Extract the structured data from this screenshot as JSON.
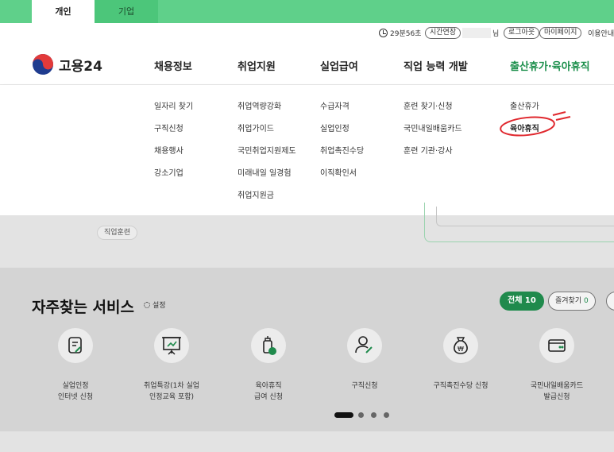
{
  "tabs": [
    {
      "label": "개인",
      "active": true
    },
    {
      "label": "기업",
      "active": false
    }
  ],
  "util": {
    "timer": "29분56초",
    "extend_label": "시간연장",
    "user_suffix": "님",
    "logout_label": "로그아웃",
    "mypage_label": "마이페이지",
    "guide_label": "이용안내"
  },
  "logo": {
    "text": "고용24"
  },
  "gnb": [
    {
      "label": "채용정보"
    },
    {
      "label": "취업지원"
    },
    {
      "label": "실업급여"
    },
    {
      "label": "직업 능력 개발"
    },
    {
      "label": "출산휴가·육아휴직"
    }
  ],
  "submenu": {
    "col1": [
      "일자리 찾기",
      "구직신청",
      "채용행사",
      "강소기업"
    ],
    "col2": [
      "취업역량강화",
      "취업가이드",
      "국민취업지원제도",
      "미래내일 일경험",
      "취업지원금"
    ],
    "col3": [
      "수급자격",
      "실업인정",
      "취업촉진수당",
      "이직확인서"
    ],
    "col4": [
      "훈련 찾기·신청",
      "국민내일배움카드",
      "훈련 기관·강사"
    ],
    "col5": [
      "출산휴가",
      "육아휴직"
    ]
  },
  "background": {
    "chip": "직업훈련"
  },
  "services": {
    "title": "자주찾는 서비스",
    "setting_label": "설정",
    "all_label": "전체 10",
    "fav_label": "즐겨찾기",
    "fav_count": "0",
    "items": [
      {
        "icon": "document-edit-icon",
        "line1": "실업인정",
        "line2": "인터넷 신청"
      },
      {
        "icon": "presentation-board-icon",
        "line1": "취업특강(1차 실업",
        "line2": "인정교육 포함)"
      },
      {
        "icon": "baby-bottle-icon",
        "line1": "육아휴직",
        "line2": "급여 신청"
      },
      {
        "icon": "person-edit-icon",
        "line1": "구직신청",
        "line2": ""
      },
      {
        "icon": "money-bag-icon",
        "line1": "구직촉진수당 신청",
        "line2": ""
      },
      {
        "icon": "card-icon",
        "line1": "국민내일배움카드",
        "line2": "발급신청"
      }
    ]
  },
  "colors": {
    "brand_green": "#1f8a4c",
    "top_strip": "#5fd08a",
    "annotation_red": "#e0282e"
  }
}
